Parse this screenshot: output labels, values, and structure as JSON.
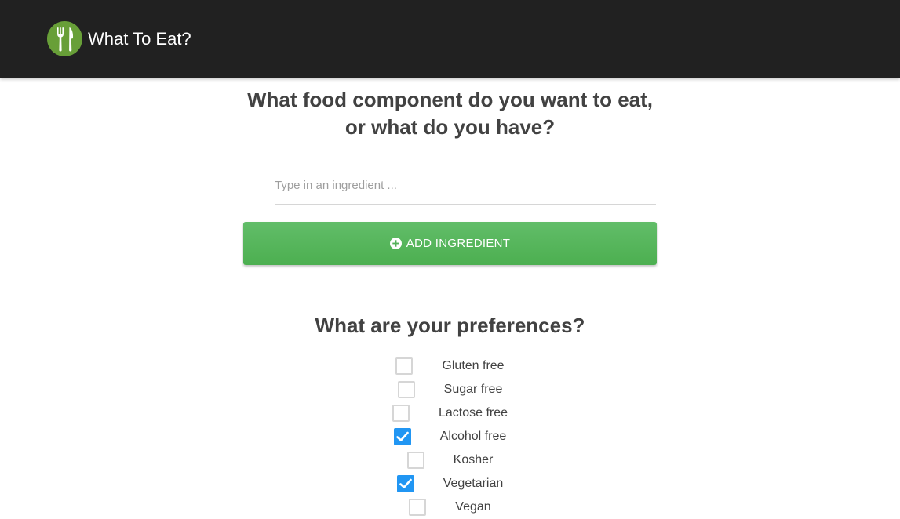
{
  "header": {
    "logo_icon": "fork-knife-icon",
    "title": "What To Eat?",
    "bg_color": "#212121",
    "logo_color": "#689f38"
  },
  "main": {
    "question": "What food component do you want to eat, or what do you have?",
    "ingredient_input": {
      "placeholder": "Type in an ingredient ...",
      "value": ""
    },
    "add_button": {
      "icon": "plus-circle-icon",
      "label": "ADD INGREDIENT",
      "color": "#4caf50"
    },
    "preferences_title": "What are your preferences?",
    "preferences": [
      {
        "label": "Gluten free",
        "checked": false
      },
      {
        "label": "Sugar free",
        "checked": false
      },
      {
        "label": "Lactose free",
        "checked": false
      },
      {
        "label": "Alcohol free",
        "checked": true
      },
      {
        "label": "Kosher",
        "checked": false
      },
      {
        "label": "Vegetarian",
        "checked": true
      },
      {
        "label": "Vegan",
        "checked": false
      }
    ],
    "checkbox_checked_color": "#2196f3"
  }
}
